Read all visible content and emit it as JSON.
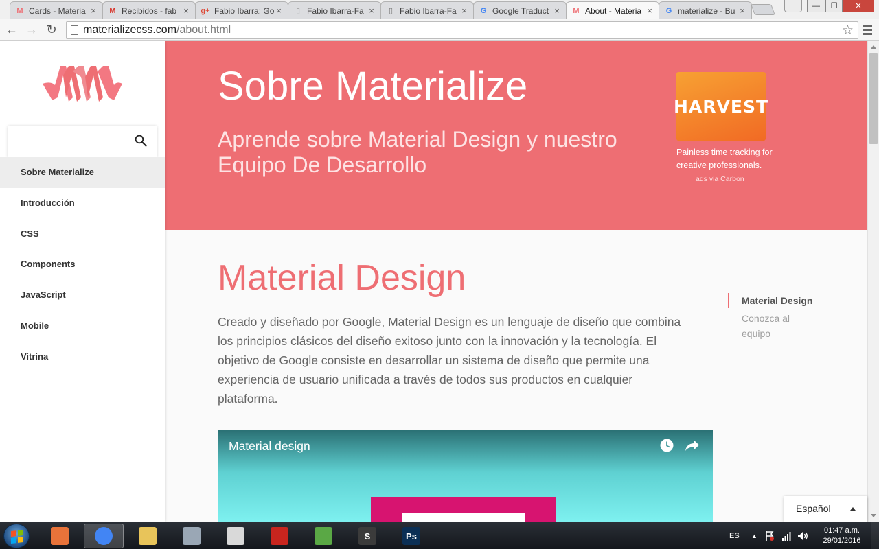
{
  "browser": {
    "tabs": [
      {
        "title": "Cards - Materia",
        "icon": "materialize-favicon",
        "icon_color": "#ee6e73"
      },
      {
        "title": "Recibidos - fab",
        "icon": "gmail-favicon",
        "icon_color": "#d93025"
      },
      {
        "title": "Fabio Ibarra: Go",
        "icon": "google-plus-favicon",
        "icon_color": "#dd4b39"
      },
      {
        "title": "Fabio Ibarra-Fa",
        "icon": "page-favicon",
        "icon_color": "#777777"
      },
      {
        "title": "Fabio Ibarra-Fa",
        "icon": "page-favicon",
        "icon_color": "#777777"
      },
      {
        "title": "Google Traduct",
        "icon": "google-translate-favicon",
        "icon_color": "#4285f4"
      },
      {
        "title": "About - Materia",
        "icon": "materialize-favicon",
        "icon_color": "#ee6e73",
        "active": true
      },
      {
        "title": "materialize - Bu",
        "icon": "google-favicon",
        "icon_color": "#4285f4"
      }
    ],
    "address": {
      "domain": "materializecss.com",
      "path": "/about.html"
    }
  },
  "sidebar": {
    "search_placeholder": "",
    "items": [
      {
        "label": "Sobre Materialize",
        "active": true
      },
      {
        "label": "Introducción"
      },
      {
        "label": "CSS"
      },
      {
        "label": "Components"
      },
      {
        "label": "JavaScript"
      },
      {
        "label": "Mobile"
      },
      {
        "label": "Vitrina"
      }
    ]
  },
  "hero": {
    "title": "Sobre Materialize",
    "subtitle": "Aprende sobre Material Design y nuestro Equipo De Desarrollo",
    "ad": {
      "brand": "HARVEST",
      "text": "Painless time tracking for creative professionals.",
      "via": "ads via Carbon"
    }
  },
  "content": {
    "heading": "Material Design",
    "paragraph": "Creado y diseñado por Google, Material Design es un lenguaje de diseño que combina los principios clásicos del diseño exitoso junto con la innovación y la tecnología. El objetivo de Google consiste en desarrollar un sistema de diseño que permite una experiencia de usuario unificada a través de todos sus productos en cualquier plataforma.",
    "video_title": "Material design",
    "toc": [
      "Material Design",
      "Conozca al equipo"
    ]
  },
  "language_picker": {
    "value": "Español"
  },
  "taskbar": {
    "apps": [
      {
        "name": "media-player",
        "color": "#e8733a"
      },
      {
        "name": "chrome",
        "color": "#4285f4",
        "active": true
      },
      {
        "name": "file-explorer",
        "color": "#e8c45a"
      },
      {
        "name": "calculator",
        "color": "#9aa7b5"
      },
      {
        "name": "inkscape",
        "color": "#d9d9d9"
      },
      {
        "name": "autocad",
        "color": "#c8251e"
      },
      {
        "name": "sketchup",
        "color": "#5aa845"
      },
      {
        "name": "sublime-text",
        "label": "S",
        "color": "#3b3b3b"
      },
      {
        "name": "photoshop",
        "label": "Ps",
        "color": "#0b2f55"
      }
    ],
    "language": "ES",
    "time": "01:47 a.m.",
    "date": "29/01/2016"
  },
  "colors": {
    "accent": "#ee6e73",
    "accent_light": "#fde2e3",
    "harvest_orange": "#f16a24",
    "video_pink": "#d71470"
  }
}
